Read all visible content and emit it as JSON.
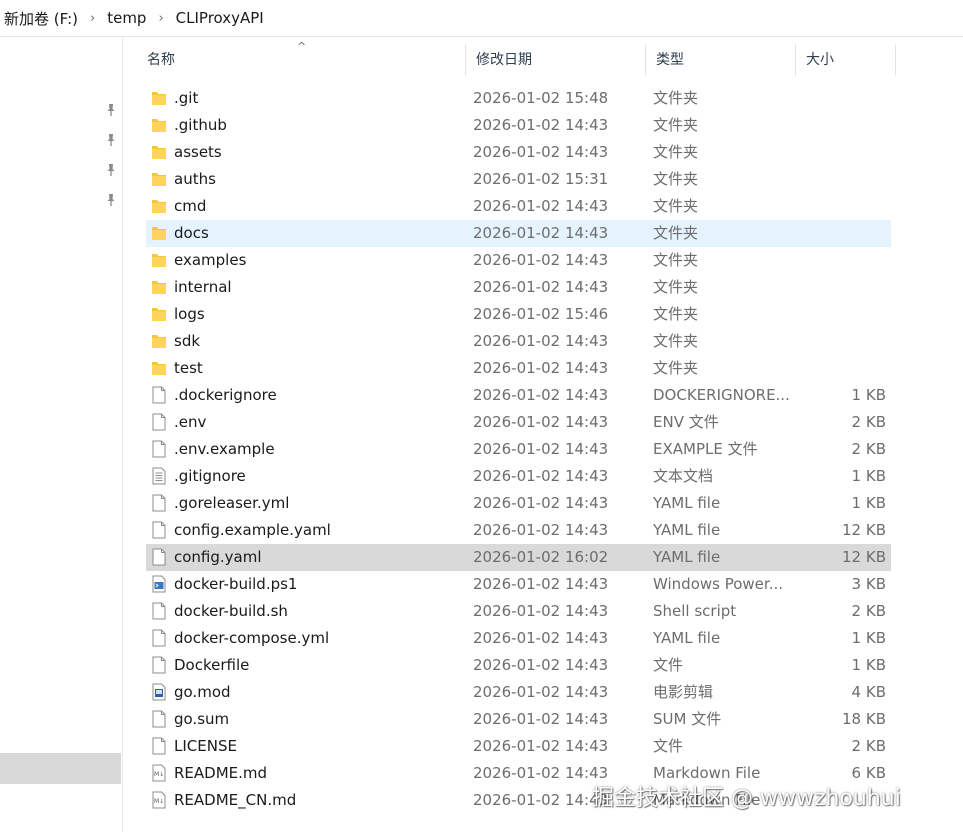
{
  "breadcrumb": {
    "items": [
      "新加卷 (F:)",
      "temp",
      "CLIProxyAPI"
    ],
    "separator": "›"
  },
  "columns": {
    "name": "名称",
    "date": "修改日期",
    "type": "类型",
    "size": "大小",
    "sort_indicator": "^"
  },
  "colors": {
    "folder": "#f4c542",
    "hover_row": "#e5f3ff",
    "selected_row": "#d9d9d9"
  },
  "files": [
    {
      "name": ".git",
      "date": "2026-01-02 15:48",
      "type": "文件夹",
      "size": "",
      "icon": "folder-icon",
      "state": ""
    },
    {
      "name": ".github",
      "date": "2026-01-02 14:43",
      "type": "文件夹",
      "size": "",
      "icon": "folder-icon",
      "state": ""
    },
    {
      "name": "assets",
      "date": "2026-01-02 14:43",
      "type": "文件夹",
      "size": "",
      "icon": "folder-icon",
      "state": ""
    },
    {
      "name": "auths",
      "date": "2026-01-02 15:31",
      "type": "文件夹",
      "size": "",
      "icon": "folder-icon",
      "state": ""
    },
    {
      "name": "cmd",
      "date": "2026-01-02 14:43",
      "type": "文件夹",
      "size": "",
      "icon": "folder-icon",
      "state": ""
    },
    {
      "name": "docs",
      "date": "2026-01-02 14:43",
      "type": "文件夹",
      "size": "",
      "icon": "folder-icon",
      "state": "hover"
    },
    {
      "name": "examples",
      "date": "2026-01-02 14:43",
      "type": "文件夹",
      "size": "",
      "icon": "folder-icon",
      "state": ""
    },
    {
      "name": "internal",
      "date": "2026-01-02 14:43",
      "type": "文件夹",
      "size": "",
      "icon": "folder-icon",
      "state": ""
    },
    {
      "name": "logs",
      "date": "2026-01-02 15:46",
      "type": "文件夹",
      "size": "",
      "icon": "folder-icon",
      "state": ""
    },
    {
      "name": "sdk",
      "date": "2026-01-02 14:43",
      "type": "文件夹",
      "size": "",
      "icon": "folder-icon",
      "state": ""
    },
    {
      "name": "test",
      "date": "2026-01-02 14:43",
      "type": "文件夹",
      "size": "",
      "icon": "folder-icon",
      "state": ""
    },
    {
      "name": ".dockerignore",
      "date": "2026-01-02 14:43",
      "type": "DOCKERIGNORE...",
      "size": "1 KB",
      "icon": "file-icon",
      "state": ""
    },
    {
      "name": ".env",
      "date": "2026-01-02 14:43",
      "type": "ENV 文件",
      "size": "2 KB",
      "icon": "file-icon",
      "state": ""
    },
    {
      "name": ".env.example",
      "date": "2026-01-02 14:43",
      "type": "EXAMPLE 文件",
      "size": "2 KB",
      "icon": "file-icon",
      "state": ""
    },
    {
      "name": ".gitignore",
      "date": "2026-01-02 14:43",
      "type": "文本文档",
      "size": "1 KB",
      "icon": "text-file-icon",
      "state": ""
    },
    {
      "name": ".goreleaser.yml",
      "date": "2026-01-02 14:43",
      "type": "YAML file",
      "size": "1 KB",
      "icon": "file-icon",
      "state": ""
    },
    {
      "name": "config.example.yaml",
      "date": "2026-01-02 14:43",
      "type": "YAML file",
      "size": "12 KB",
      "icon": "file-icon",
      "state": ""
    },
    {
      "name": "config.yaml",
      "date": "2026-01-02 16:02",
      "type": "YAML file",
      "size": "12 KB",
      "icon": "file-icon",
      "state": "selected"
    },
    {
      "name": "docker-build.ps1",
      "date": "2026-01-02 14:43",
      "type": "Windows Power...",
      "size": "3 KB",
      "icon": "powershell-file-icon",
      "state": ""
    },
    {
      "name": "docker-build.sh",
      "date": "2026-01-02 14:43",
      "type": "Shell script",
      "size": "2 KB",
      "icon": "file-icon",
      "state": ""
    },
    {
      "name": "docker-compose.yml",
      "date": "2026-01-02 14:43",
      "type": "YAML file",
      "size": "1 KB",
      "icon": "file-icon",
      "state": ""
    },
    {
      "name": "Dockerfile",
      "date": "2026-01-02 14:43",
      "type": "文件",
      "size": "1 KB",
      "icon": "file-icon",
      "state": ""
    },
    {
      "name": "go.mod",
      "date": "2026-01-02 14:43",
      "type": "电影剪辑",
      "size": "4 KB",
      "icon": "video-file-icon",
      "state": ""
    },
    {
      "name": "go.sum",
      "date": "2026-01-02 14:43",
      "type": "SUM 文件",
      "size": "18 KB",
      "icon": "file-icon",
      "state": ""
    },
    {
      "name": "LICENSE",
      "date": "2026-01-02 14:43",
      "type": "文件",
      "size": "2 KB",
      "icon": "file-icon",
      "state": ""
    },
    {
      "name": "README.md",
      "date": "2026-01-02 14:43",
      "type": "Markdown File",
      "size": "6 KB",
      "icon": "markdown-file-icon",
      "state": ""
    },
    {
      "name": "README_CN.md",
      "date": "2026-01-02 14:43",
      "type": "Markdown File",
      "size": "",
      "icon": "markdown-file-icon",
      "state": ""
    }
  ],
  "watermark": "掘金技术社区 @ wwwzhouhui"
}
